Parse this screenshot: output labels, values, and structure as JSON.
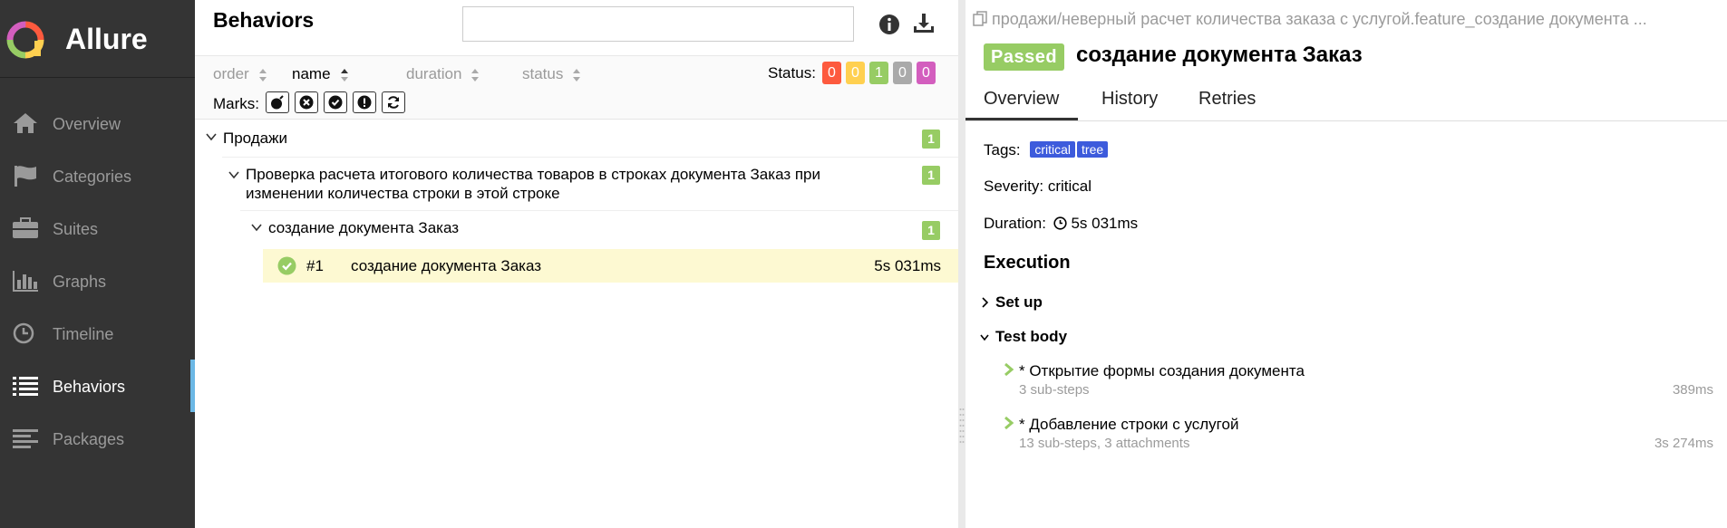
{
  "app": {
    "name": "Allure"
  },
  "sidebar": {
    "items": [
      {
        "label": "Overview",
        "icon": "home-icon"
      },
      {
        "label": "Categories",
        "icon": "flag-icon"
      },
      {
        "label": "Suites",
        "icon": "briefcase-icon"
      },
      {
        "label": "Graphs",
        "icon": "bar-chart-icon"
      },
      {
        "label": "Timeline",
        "icon": "clock-icon"
      },
      {
        "label": "Behaviors",
        "icon": "list-icon",
        "active": true
      },
      {
        "label": "Packages",
        "icon": "align-left-icon"
      }
    ]
  },
  "behaviors": {
    "title": "Behaviors",
    "search_value": "",
    "sort": {
      "order": "order",
      "name": "name",
      "duration": "duration",
      "status": "status"
    },
    "status_label": "Status:",
    "status_counts": [
      {
        "value": "0",
        "color": "#fd5a3e"
      },
      {
        "value": "0",
        "color": "#ffd050"
      },
      {
        "value": "1",
        "color": "#97cc64"
      },
      {
        "value": "0",
        "color": "#aaaaaa"
      },
      {
        "value": "0",
        "color": "#d35ebe"
      }
    ],
    "marks_label": "Marks:",
    "marks": [
      "flaky-bomb-icon",
      "new-failed-icon",
      "new-passed-icon",
      "new-broken-icon",
      "retries-icon"
    ],
    "tree": {
      "group": {
        "name": "Продажи",
        "count": "1"
      },
      "feature": {
        "name_line1": "Проверка расчета итогового количества товаров в строках документа Заказ при",
        "name_line2": "изменении количества строки в этой строке",
        "count": "1"
      },
      "story": {
        "name": "создание документа Заказ",
        "count": "1"
      },
      "test": {
        "number": "#1",
        "name": "создание документа Заказ",
        "duration": "5s 031ms"
      }
    }
  },
  "testcase": {
    "path": "продажи/неверный расчет количества заказа с услугой.feature_создание документа ...",
    "status": "Passed",
    "title": "создание документа Заказ",
    "tabs": [
      "Overview",
      "History",
      "Retries"
    ],
    "tags_label": "Tags:",
    "tags": [
      "critical",
      "tree"
    ],
    "severity": "Severity: critical",
    "duration_label": "Duration:",
    "duration": "5s 031ms",
    "execution_title": "Execution",
    "setup_label": "Set up",
    "body_label": "Test body",
    "steps": [
      {
        "title": "* Открытие формы создания документа",
        "sub": "3 sub-steps",
        "duration": "389ms"
      },
      {
        "title": "* Добавление строки с услугой",
        "sub": "13 sub-steps, 3 attachments",
        "duration": "3s 274ms"
      }
    ]
  },
  "colors": {
    "sidebar_bg": "#343434",
    "accent": "#6cb8e5",
    "passed": "#97cc64",
    "tag": "#3d5bdc",
    "selected_row": "#fdf9d2"
  }
}
